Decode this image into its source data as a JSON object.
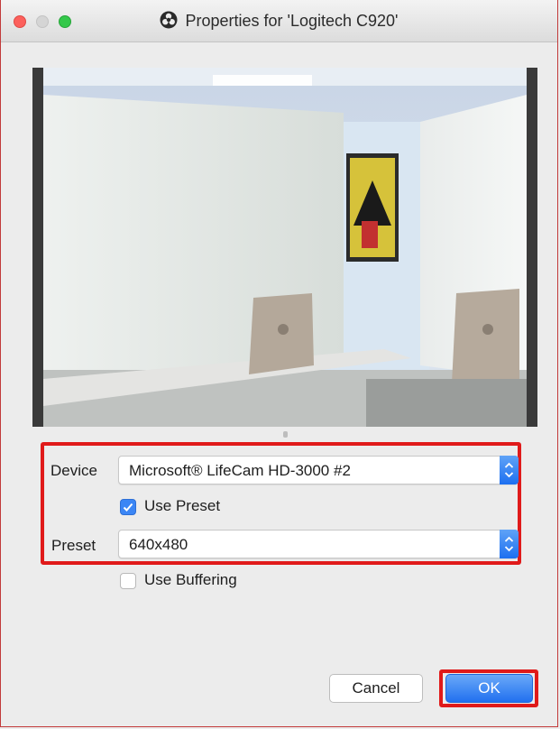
{
  "window": {
    "title": "Properties for 'Logitech C920'",
    "icon": "obs-icon",
    "controls": [
      "close",
      "minimize",
      "maximize"
    ]
  },
  "preview": {
    "icon": "camera-preview-image"
  },
  "form": {
    "device_label": "Device",
    "device_value": "Microsoft® LifeCam HD-3000 #2",
    "use_preset_label": "Use Preset",
    "use_preset_checked": true,
    "preset_label": "Preset",
    "preset_value": "640x480",
    "use_buffering_label": "Use Buffering",
    "use_buffering_checked": false
  },
  "buttons": {
    "cancel_label": "Cancel",
    "ok_label": "OK"
  },
  "colors": {
    "accent": "#1d6ff0",
    "highlight": "#e01a1a",
    "close": "#fc605c",
    "maximize": "#34c84a"
  }
}
